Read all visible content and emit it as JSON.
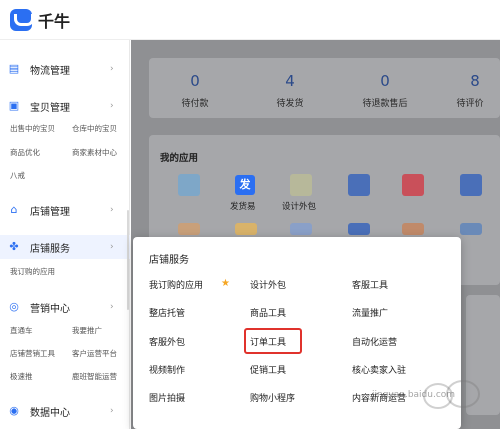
{
  "app": {
    "title": "千牛"
  },
  "sidebar": {
    "sections": [
      {
        "icon": "logistics-icon",
        "label": "物流管理"
      },
      {
        "icon": "shop-item-icon",
        "label": "宝贝管理"
      },
      {
        "icon": "store-icon",
        "label": "店铺管理"
      },
      {
        "icon": "apps-grid-icon",
        "label": "店铺服务"
      },
      {
        "icon": "marketing-icon",
        "label": "营销中心"
      },
      {
        "icon": "data-icon",
        "label": "数据中心"
      }
    ],
    "baobei_links": [
      "出售中的宝贝",
      "仓库中的宝贝",
      "商品优化",
      "商家素材中心",
      "八戒"
    ],
    "service_links": [
      "我订购的应用"
    ],
    "marketing_links": [
      "直通车",
      "我要推广",
      "店铺营销工具",
      "客户运营平台",
      "极速推",
      "鹿班智能运营"
    ]
  },
  "stats": [
    {
      "value": "0",
      "label": "待付款"
    },
    {
      "value": "4",
      "label": "待发货"
    },
    {
      "value": "0",
      "label": "待退款售后"
    },
    {
      "value": "8",
      "label": "待评价"
    }
  ],
  "apps": {
    "title": "我的应用",
    "named": [
      {
        "label": "发货易",
        "glyph": "发"
      },
      {
        "label": "设计外包"
      }
    ]
  },
  "popup": {
    "title": "店铺服务",
    "columns": [
      [
        "我订购的应用",
        "整店托管",
        "客服外包",
        "视频制作",
        "图片拍摄"
      ],
      [
        "设计外包",
        "商品工具",
        "订单工具",
        "促销工具",
        "购物小程序"
      ],
      [
        "客服工具",
        "流量推广",
        "自动化运营",
        "核心卖家入驻",
        "内容新商运营"
      ]
    ],
    "highlighted": "订单工具"
  },
  "watermark": {
    "text": "jingyan.baidu.com"
  },
  "colors": {
    "accent": "#2b6ff2",
    "highlight": "#e0322c",
    "star": "#f5a623"
  }
}
